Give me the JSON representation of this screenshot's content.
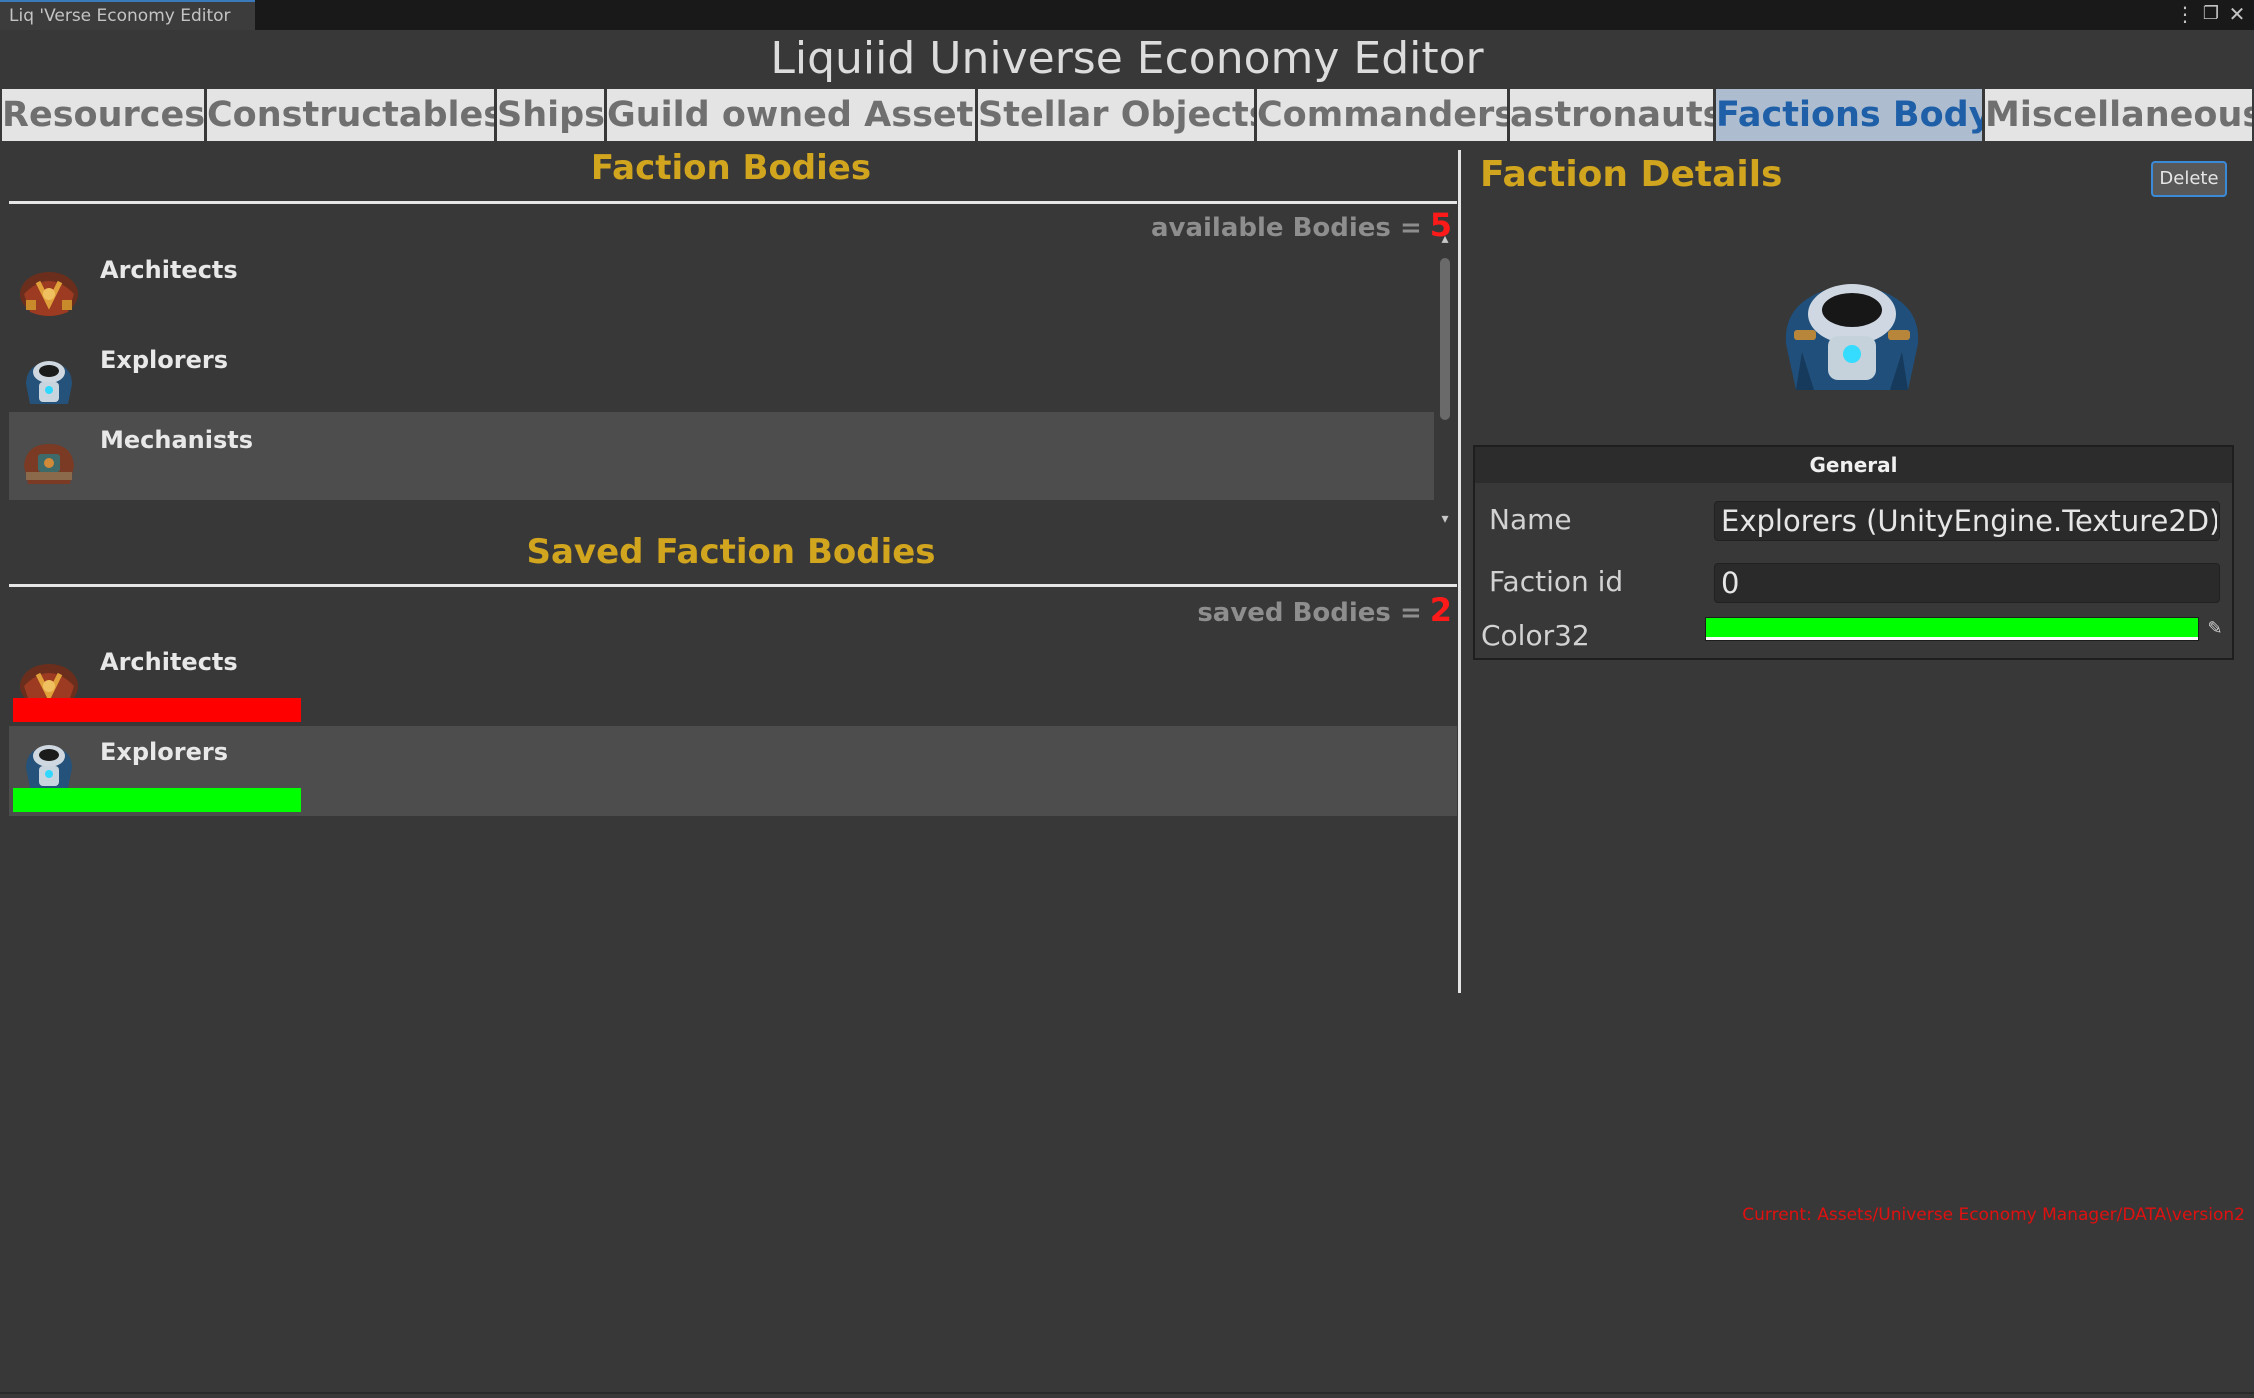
{
  "window": {
    "tab_title": "Liq 'Verse Economy Editor",
    "controls": [
      "⋮",
      "❐",
      "✕"
    ]
  },
  "app_title": "Liquiid Universe Economy Editor",
  "tabs": [
    {
      "label": "Resources",
      "active": false
    },
    {
      "label": "Constructables",
      "active": false
    },
    {
      "label": "Ships",
      "active": false
    },
    {
      "label": "Guild owned Assets",
      "active": false
    },
    {
      "label": "Stellar Objects",
      "active": false
    },
    {
      "label": "Commanders",
      "active": false
    },
    {
      "label": "astronauts",
      "active": false
    },
    {
      "label": "Factions Body",
      "active": true
    },
    {
      "label": "Miscellaneous",
      "active": false
    }
  ],
  "faction_bodies": {
    "title": "Faction Bodies",
    "count_label": "available Bodies =",
    "count_value": "5",
    "items": [
      {
        "label": "Architects",
        "icon": "architect-armor-icon",
        "selected": false
      },
      {
        "label": "Explorers",
        "icon": "explorer-suit-icon",
        "selected": false
      },
      {
        "label": "Mechanists",
        "icon": "mechanist-armor-icon",
        "selected": true
      }
    ]
  },
  "saved_bodies": {
    "title": "Saved Faction Bodies",
    "count_label": "saved Bodies =",
    "count_value": "2",
    "items": [
      {
        "label": "Architects",
        "icon": "architect-armor-icon",
        "color": "#ff0000",
        "selected": false
      },
      {
        "label": "Explorers",
        "icon": "explorer-suit-icon",
        "color": "#00ff00",
        "selected": true
      }
    ]
  },
  "details": {
    "title": "Faction Details",
    "delete_label": "Delete",
    "preview_icon": "explorer-suit-icon",
    "group_title": "General",
    "name_label": "Name",
    "name_value": "Explorers (UnityEngine.Texture2D)",
    "faction_id_label": "Faction id",
    "faction_id_value": "0",
    "color_label": "Color32",
    "color_value": "#00ff00"
  },
  "status_path": "Current: Assets/Universe Economy Manager/DATA\\version2"
}
